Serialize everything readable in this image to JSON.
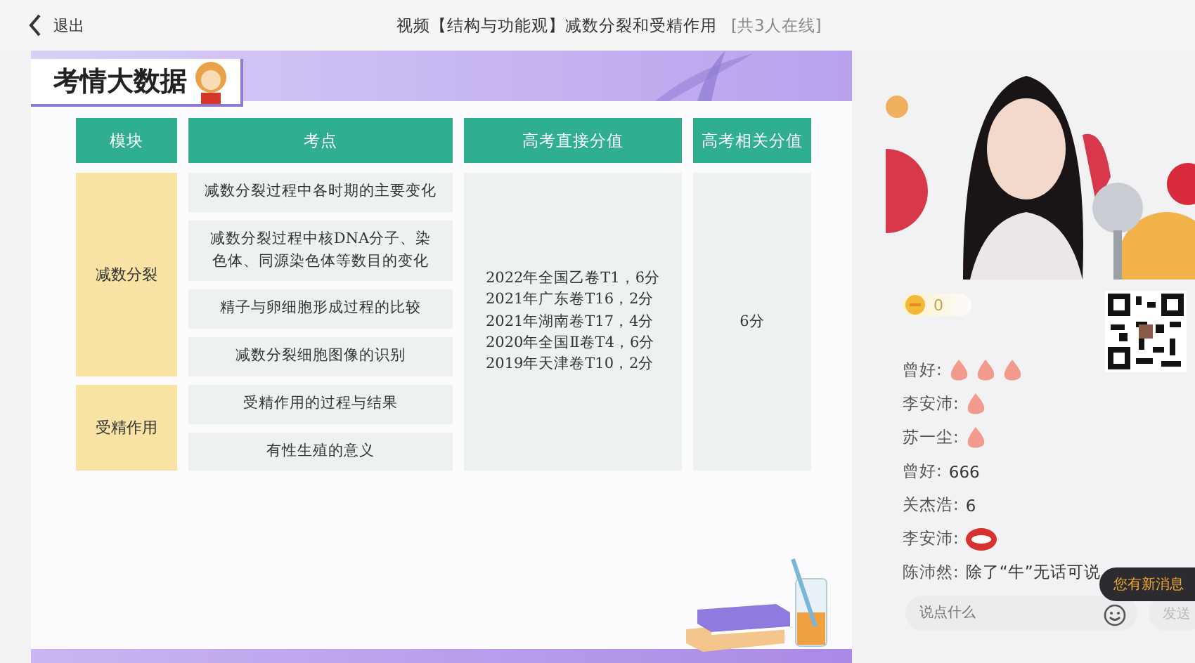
{
  "top_bar": {
    "back_label": "退出",
    "title": "视频【结构与功能观】减数分裂和受精作用",
    "online_count": "[共3人在线]"
  },
  "slide": {
    "heading": "考情大数据",
    "table": {
      "columns": [
        "模块",
        "考点",
        "高考直接分值",
        "高考相关分值"
      ],
      "modules": [
        {
          "name": "减数分裂",
          "points": [
            "减数分裂过程中各时期的主要变化",
            "减数分裂过程中核DNA分子、染色体、同源染色体等数目的变化",
            "精子与卵细胞形成过程的比较",
            "减数分裂细胞图像的识别"
          ]
        },
        {
          "name": "受精作用",
          "points": [
            "受精作用的过程与结果",
            "有性生殖的意义"
          ]
        }
      ],
      "direct_scores": [
        "2022年全国乙卷T1，6分",
        "2021年广东卷T16，2分",
        "2021年湖南卷T17，4分",
        "2020年全国Ⅱ卷T4，6分",
        "2019年天津卷T10，2分"
      ],
      "related_score": "6分"
    }
  },
  "chat": {
    "coins": "0",
    "messages": [
      {
        "kind": "icons",
        "user": "曾好:",
        "icons": [
          {
            "kind": "clap"
          },
          {
            "kind": "clap"
          },
          {
            "kind": "clap"
          }
        ]
      },
      {
        "kind": "icons",
        "user": "李安沛:",
        "icons": [
          {
            "kind": "clap"
          }
        ]
      },
      {
        "kind": "icons",
        "user": "苏一尘:",
        "icons": [
          {
            "kind": "clap"
          }
        ]
      },
      {
        "kind": "text",
        "user": "曾好:",
        "text": "666"
      },
      {
        "kind": "text",
        "user": "关杰浩:",
        "text": "6"
      },
      {
        "kind": "icons",
        "user": "李安沛:",
        "icons": [
          {
            "kind": "laugh"
          }
        ]
      },
      {
        "kind": "text",
        "user": "陈沛然:",
        "text": "除了“牛”无话可说"
      }
    ],
    "new_message_badge": "您有新消息",
    "input": {
      "placeholder": "说点什么"
    },
    "send": {
      "label": "发送",
      "disabled": true
    }
  }
}
